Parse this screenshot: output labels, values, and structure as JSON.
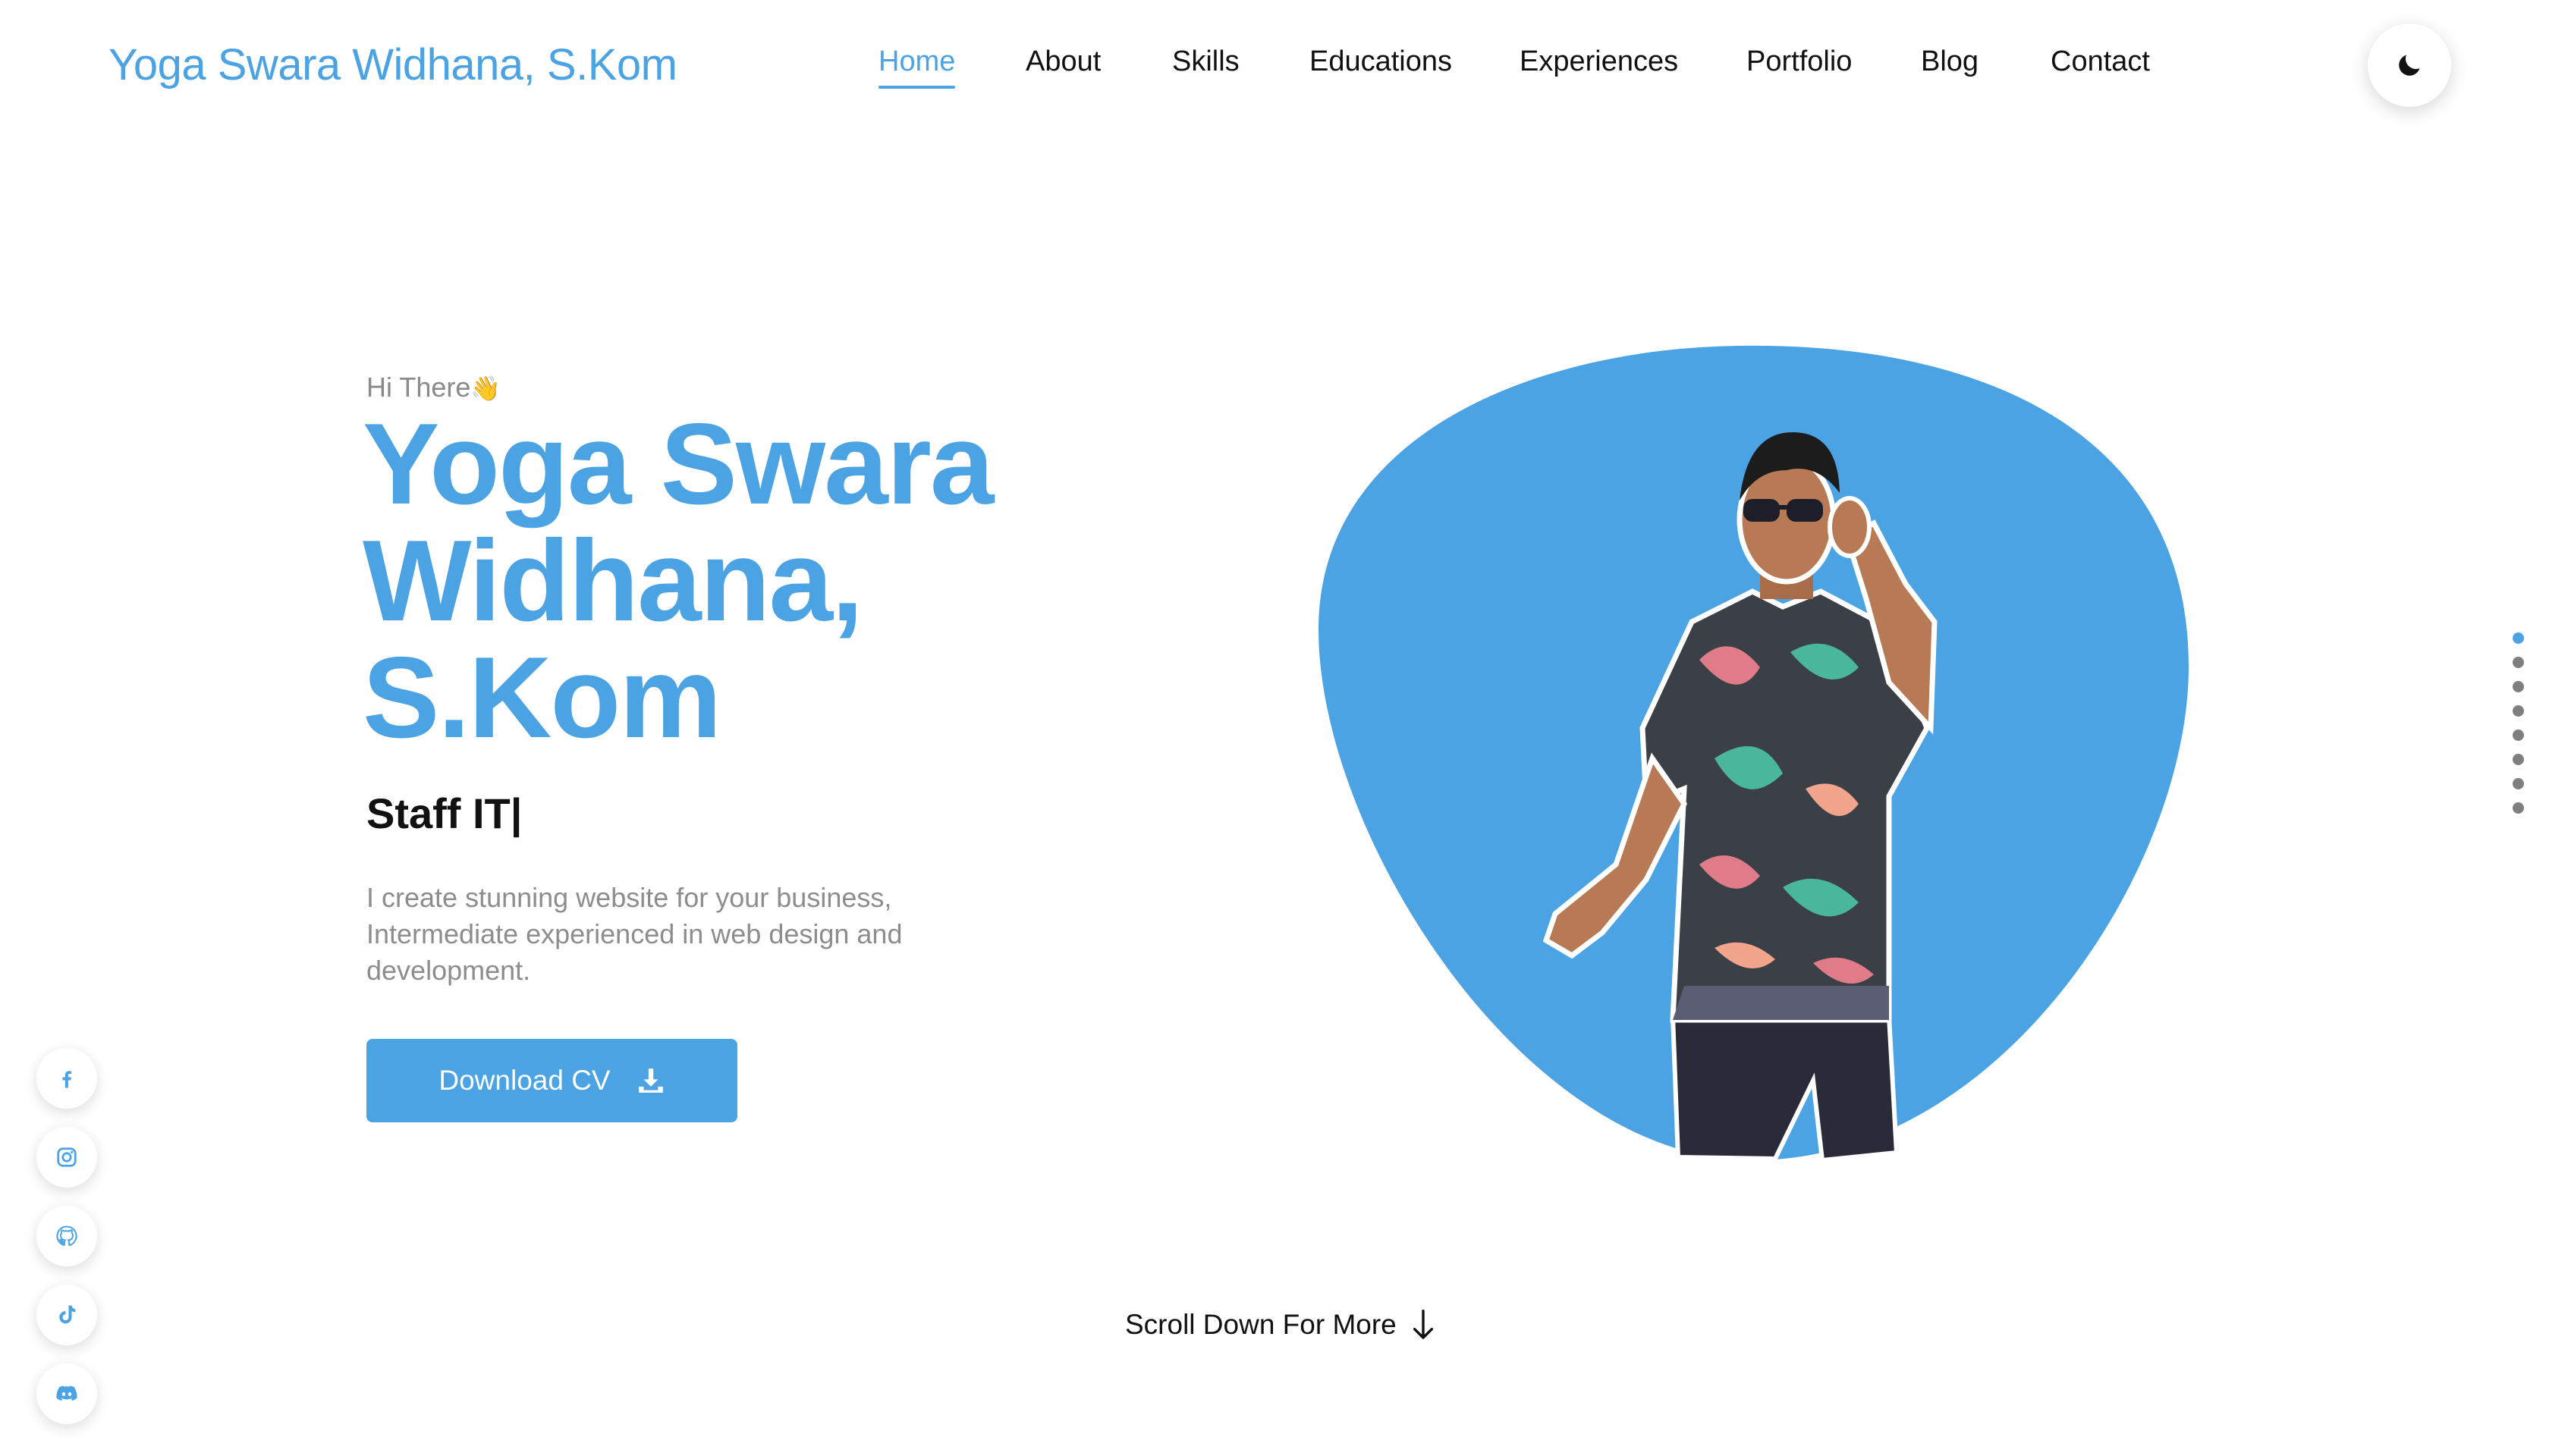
{
  "header": {
    "brand": "Yoga Swara Widhana, S.Kom",
    "nav": [
      {
        "label": "Home",
        "active": true
      },
      {
        "label": "About"
      },
      {
        "label": "Skills"
      },
      {
        "label": "Educations"
      },
      {
        "label": "Experiences"
      },
      {
        "label": "Portfolio"
      },
      {
        "label": "Blog"
      },
      {
        "label": "Contact"
      }
    ],
    "theme_toggle_icon": "moon-icon"
  },
  "hero": {
    "greeting": "Hi There",
    "greeting_emoji": "👋",
    "name": "Yoga Swara Widhana, S.Kom",
    "role": "Staff IT|",
    "description": "I create stunning website for your business, Intermediate experienced in web design and development.",
    "download_label": "Download CV",
    "download_icon": "download-icon"
  },
  "pager": {
    "count": 8,
    "active_index": 0
  },
  "socials": [
    {
      "name": "facebook-icon"
    },
    {
      "name": "instagram-icon"
    },
    {
      "name": "github-icon"
    },
    {
      "name": "tiktok-icon"
    },
    {
      "name": "discord-icon"
    }
  ],
  "scroll_hint": "Scroll Down For More",
  "colors": {
    "accent": "#4ba3e3",
    "text": "#111111",
    "muted": "#8d8d8d",
    "background": "#ffffff"
  }
}
